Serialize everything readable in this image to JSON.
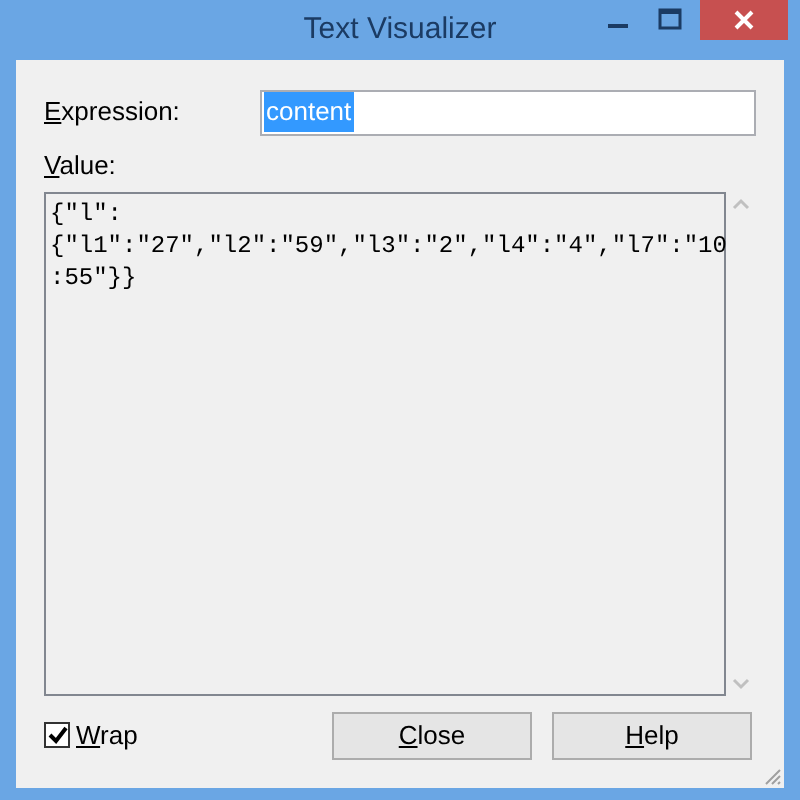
{
  "window": {
    "title": "Text Visualizer"
  },
  "expression": {
    "label": "Expression:",
    "mnemonic": true,
    "value": "content",
    "selected": true
  },
  "value": {
    "label": "Value:",
    "mnemonic": true,
    "lines": [
      "{\"l\":",
      "{\"l1\":\"27\",\"l2\":\"59\",\"l3\":\"2\",\"l4\":\"4\",\"l7\":\"10",
      ":55\"}}"
    ]
  },
  "wrap": {
    "label": "Wrap",
    "mnemonic": true,
    "checked": true
  },
  "buttons": [
    {
      "label": "Close",
      "mnemonic": true
    },
    {
      "label": "Help",
      "mnemonic": true
    }
  ]
}
